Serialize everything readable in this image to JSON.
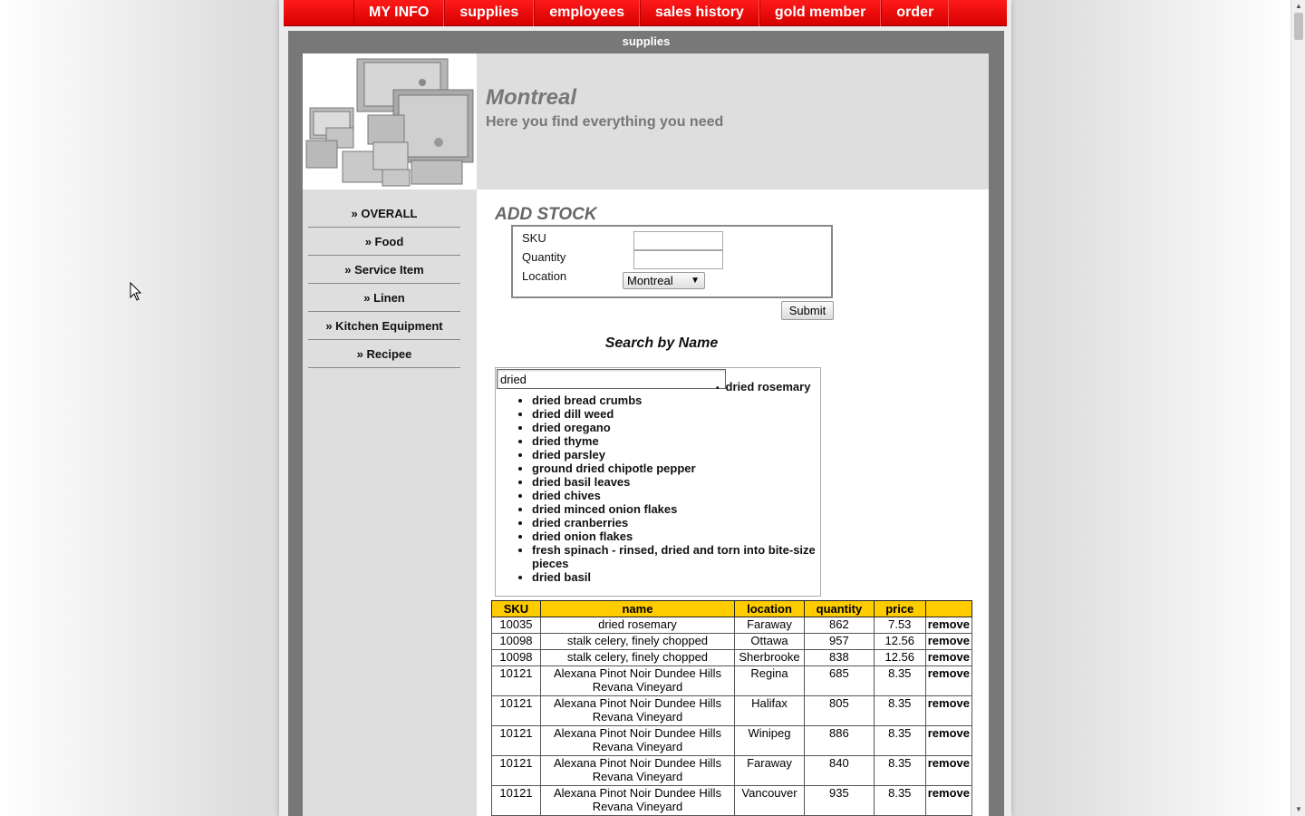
{
  "nav": {
    "items": [
      "MY INFO",
      "supplies",
      "employees",
      "sales history",
      "gold member",
      "order"
    ]
  },
  "panel_title": "supplies",
  "header": {
    "city": "Montreal",
    "tagline": "Here you find everything you need"
  },
  "sidebar": {
    "items": [
      "» OVERALL",
      "» Food",
      "» Service Item",
      "» Linen",
      "» Kitchen Equipment",
      "» Recipee"
    ]
  },
  "add_stock": {
    "title": "ADD STOCK",
    "sku_label": "SKU",
    "quantity_label": "Quantity",
    "location_label": "Location",
    "sku_value": "",
    "quantity_value": "",
    "location_value": "Montreal",
    "submit_label": "Submit"
  },
  "search": {
    "title": "Search by Name",
    "query": "dried",
    "first_suggestion": "dried rosemary",
    "suggestions": [
      "dried bread crumbs",
      "dried dill weed",
      "dried oregano",
      "dried thyme",
      "dried parsley",
      "ground dried chipotle pepper",
      "dried basil leaves",
      "dried chives",
      "dried minced onion flakes",
      "dried cranberries",
      "dried onion flakes",
      "fresh spinach - rinsed, dried and torn into bite-size pieces",
      "dried basil"
    ]
  },
  "table": {
    "headers": [
      "SKU",
      "name",
      "location",
      "quantity",
      "price",
      ""
    ],
    "rows": [
      {
        "sku": "10035",
        "name": "dried rosemary",
        "location": "Faraway",
        "quantity": "862",
        "price": "7.53",
        "action": "remove"
      },
      {
        "sku": "10098",
        "name": "stalk celery, finely chopped",
        "location": "Ottawa",
        "quantity": "957",
        "price": "12.56",
        "action": "remove"
      },
      {
        "sku": "10098",
        "name": "stalk celery, finely chopped",
        "location": "Sherbrooke",
        "quantity": "838",
        "price": "12.56",
        "action": "remove"
      },
      {
        "sku": "10121",
        "name": "Alexana Pinot Noir Dundee Hills Revana Vineyard",
        "location": "Regina",
        "quantity": "685",
        "price": "8.35",
        "action": "remove"
      },
      {
        "sku": "10121",
        "name": "Alexana Pinot Noir Dundee Hills Revana Vineyard",
        "location": "Halifax",
        "quantity": "805",
        "price": "8.35",
        "action": "remove"
      },
      {
        "sku": "10121",
        "name": "Alexana Pinot Noir Dundee Hills Revana Vineyard",
        "location": "Winipeg",
        "quantity": "886",
        "price": "8.35",
        "action": "remove"
      },
      {
        "sku": "10121",
        "name": "Alexana Pinot Noir Dundee Hills Revana Vineyard",
        "location": "Faraway",
        "quantity": "840",
        "price": "8.35",
        "action": "remove"
      },
      {
        "sku": "10121",
        "name": "Alexana Pinot Noir Dundee Hills Revana Vineyard",
        "location": "Vancouver",
        "quantity": "935",
        "price": "8.35",
        "action": "remove"
      }
    ]
  },
  "colors": {
    "nav_red": "#e00000",
    "panel_grey": "#787878",
    "table_header": "#ffcc00"
  },
  "icons": [
    "dropdown-arrow-icon",
    "mouse-cursor-icon",
    "scroll-up-icon",
    "scroll-down-icon"
  ]
}
